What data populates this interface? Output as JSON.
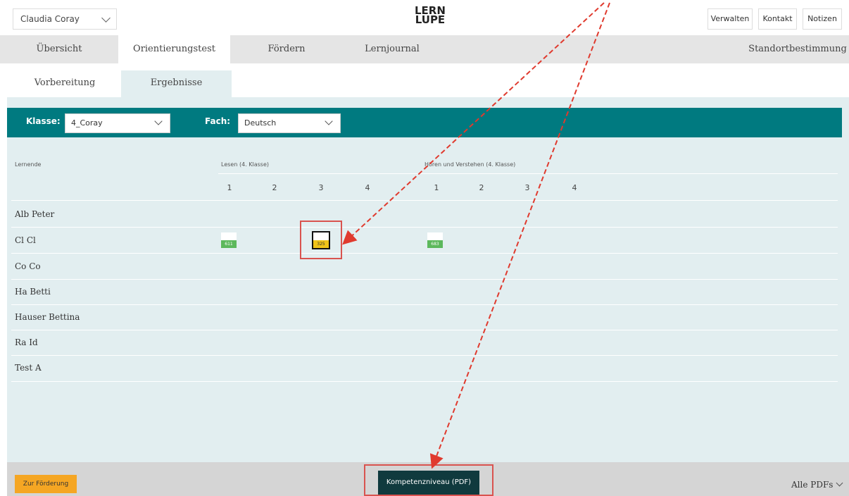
{
  "topbar": {
    "user": "Claudia Coray",
    "logo_line1": "LERN",
    "logo_line2": "LUPE",
    "buttons": [
      "Verwalten",
      "Kontakt",
      "Notizen"
    ]
  },
  "main_tabs": [
    "Übersicht",
    "Orientierungstest",
    "Fördern",
    "Lernjournal",
    "Standortbestimmung"
  ],
  "sub_tabs": [
    "Vorbereitung",
    "Ergebnisse"
  ],
  "filters": {
    "klasse_label": "Klasse:",
    "klasse_value": "4_Coray",
    "fach_label": "Fach:",
    "fach_value": "Deutsch"
  },
  "table": {
    "col_lernende": "Lernende",
    "group1": "Lesen (4. Klasse)",
    "group2": "Hören und Verstehen (4. Klasse)",
    "levels": [
      "1",
      "2",
      "3",
      "4"
    ],
    "students": [
      "Alb Peter",
      "Cl Cl",
      "Co Co",
      "Ha Betti",
      "Hauser Bettina",
      "Ra Id",
      "Test A"
    ],
    "scores": {
      "s1": "611",
      "s2": "325",
      "s3": "683"
    }
  },
  "footer": {
    "foerderung": "Zur Förderung",
    "pdf": "Kompetenzniveau (PDF)",
    "all_pdfs": "Alle PDFs"
  },
  "colors": {
    "teal": "#007a80",
    "panel": "#e2eef0",
    "orange": "#f5a623",
    "dark": "#103a3e",
    "annotation_red": "#d9534f"
  }
}
